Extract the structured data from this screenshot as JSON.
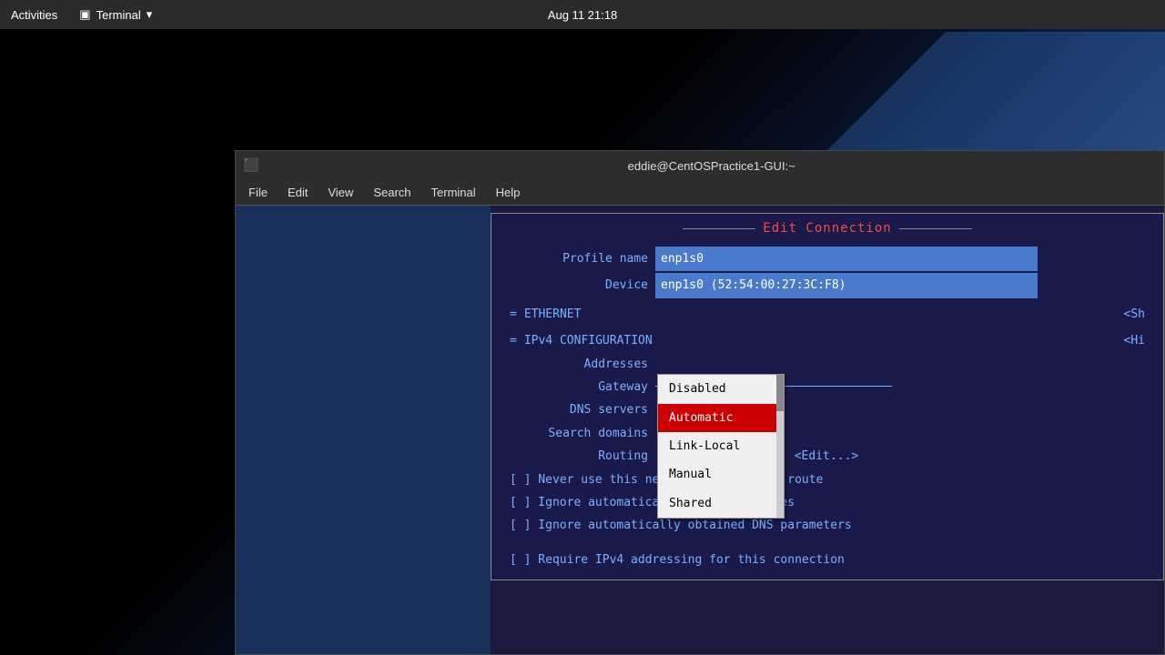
{
  "topbar": {
    "activities_label": "Activities",
    "terminal_label": "Terminal",
    "datetime": "Aug 11  21:18"
  },
  "terminal_window": {
    "title": "eddie@CentOSPractice1-GUI:~",
    "menu": {
      "file": "File",
      "edit": "Edit",
      "view": "View",
      "search": "Search",
      "terminal": "Terminal",
      "help": "Help"
    }
  },
  "edit_connection": {
    "title": "Edit Connection",
    "profile_name_label": "Profile name",
    "profile_name_value": "enp1s0",
    "device_label": "Device",
    "device_value": "enp1s0 (52:54:00:27:3C:F8)",
    "ethernet_label": "ETHERNET",
    "ethernet_show": "<Sh",
    "ipv4_label": "IPv4 CONFIGURATION",
    "ipv4_show": "<Hi",
    "addresses_label": "Addresses",
    "gateway_label": "Gateway",
    "dns_label": "DNS servers",
    "search_domains_label": "Search domains",
    "routing_label": "Routing",
    "routing_value": "(No custom routes) <Edit...>",
    "checkbox1": "[ ] Never use this network for default route",
    "checkbox2": "[ ] Ignore automatically obtained routes",
    "checkbox3": "[ ] Ignore automatically obtained DNS parameters",
    "checkbox4": "[ ] Require IPv4 addressing for this connection",
    "dropdown": {
      "items": [
        "Disabled",
        "Automatic",
        "Link-Local",
        "Manual",
        "Shared"
      ],
      "selected": "Automatic"
    }
  }
}
